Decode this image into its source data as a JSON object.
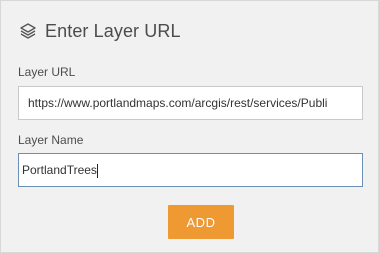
{
  "header": {
    "icon": "layers-icon",
    "title": "Enter Layer URL"
  },
  "fields": {
    "url": {
      "label": "Layer URL",
      "value": "https://www.portlandmaps.com/arcgis/rest/services/Publi"
    },
    "name": {
      "label": "Layer Name",
      "value": "PortlandTrees"
    }
  },
  "actions": {
    "add_label": "ADD"
  },
  "colors": {
    "panel_background": "#f1f1f1",
    "accent_button": "#ee9932",
    "focused_border": "#6b8fb5"
  }
}
